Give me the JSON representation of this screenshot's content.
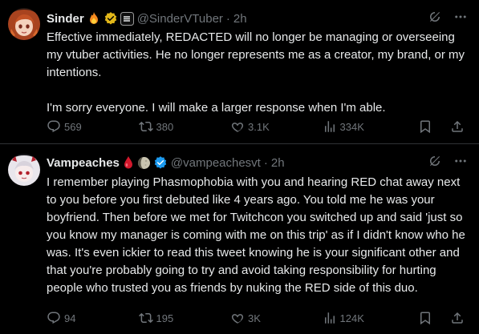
{
  "tweets": [
    {
      "name": "Sinder",
      "handle": "@SinderVTuber",
      "time": "2h",
      "body": [
        "Effective immediately, REDACTED will no longer be managing or overseeing my vtuber activities. He no longer represents me as a creator, my brand, or my intentions.",
        "I'm sorry everyone. I will make a larger response when I'm able."
      ],
      "stats": {
        "replies": "569",
        "reposts": "380",
        "likes": "3.1K",
        "views": "334K"
      },
      "name_badges": [
        "fire-emoji",
        "verified-gold",
        "affiliate-logo"
      ]
    },
    {
      "name": "Vampeaches",
      "handle": "@vampeachesvt",
      "time": "2h",
      "body": [
        "I remember playing Phasmophobia with you and hearing RED chat away next to you before you first debuted like 4 years ago. You told me he was your boyfriend. Then before we met for Twitchcon you switched up and said 'just so you know my manager is coming with me on this trip' as if I didn't know who he was. It's even ickier to read this tweet knowing he is your significant other and that you're probably going to try and avoid taking responsibility for hurting people who trusted you as friends by nuking the RED side of this duo."
      ],
      "stats": {
        "replies": "94",
        "reposts": "195",
        "likes": "3K",
        "views": "124K"
      },
      "name_badges": [
        "blood-drop-emoji",
        "moon-emoji",
        "verified-blue"
      ]
    }
  ],
  "colors": {
    "background": "#000000",
    "text": "#e7e9ea",
    "muted": "#71767b",
    "divider": "#2f3336",
    "verified_blue": "#1d9bf0",
    "verified_gold": "#e2b719"
  }
}
